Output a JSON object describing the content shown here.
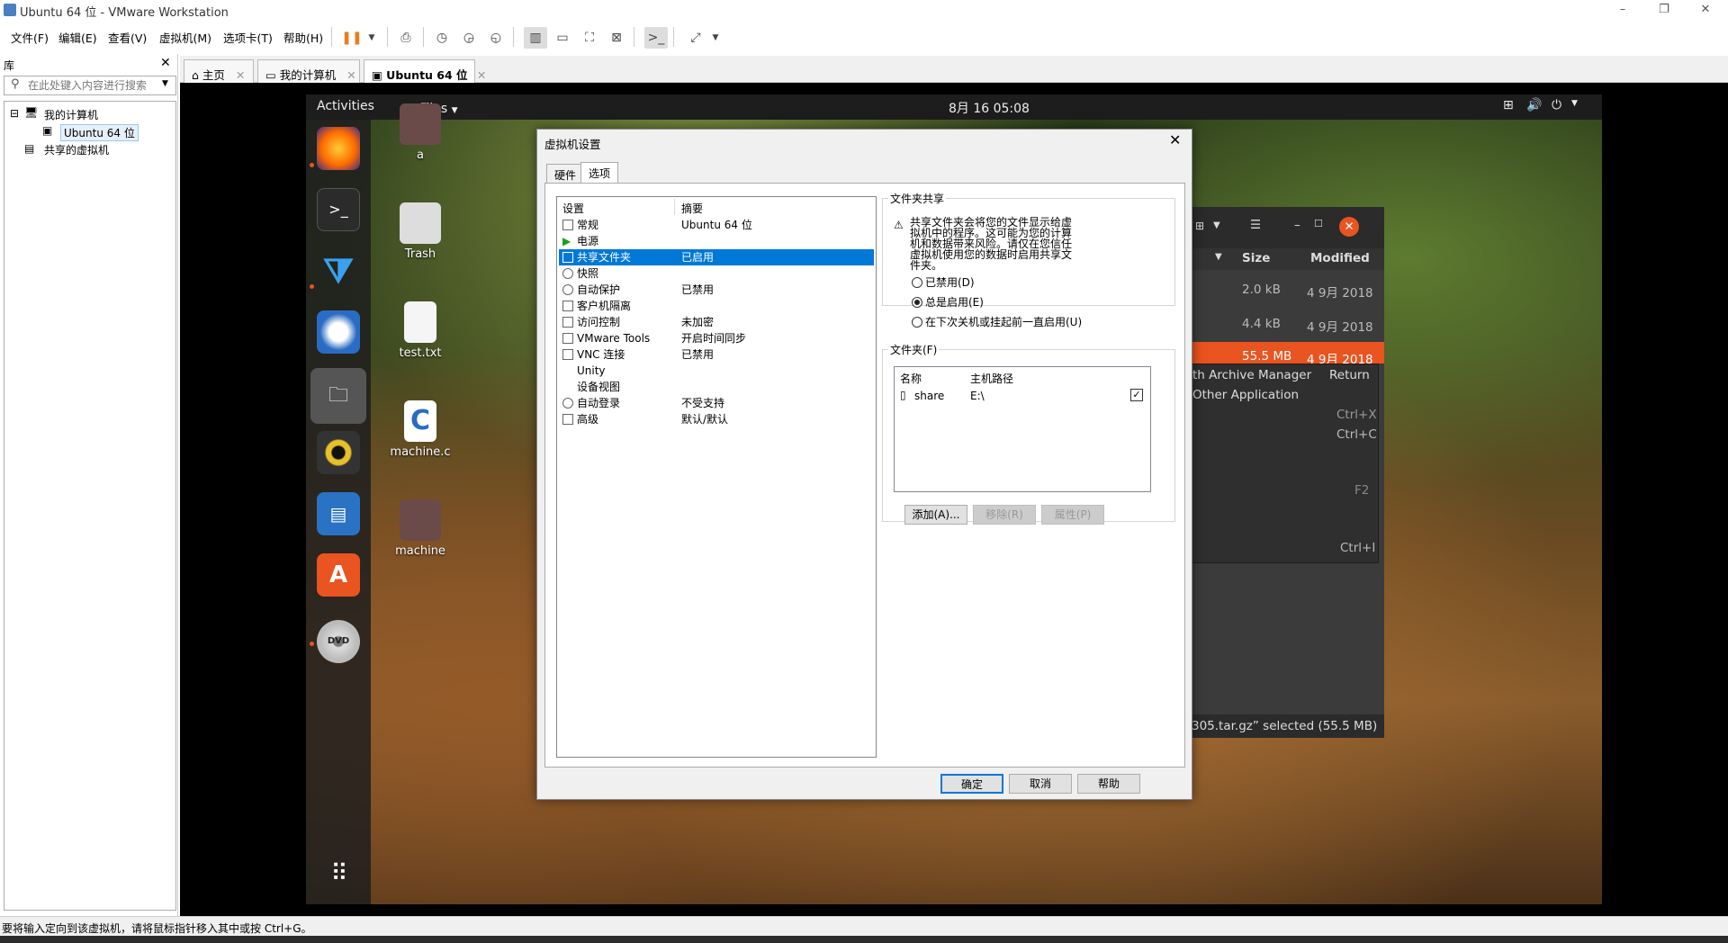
{
  "window": {
    "title": "Ubuntu 64 位 - VMware Workstation",
    "min": "–",
    "max": "❐",
    "close": "✕"
  },
  "menu": [
    "文件(F)",
    "编辑(E)",
    "查看(V)",
    "虚拟机(M)",
    "选项卡(T)",
    "帮助(H)"
  ],
  "library": {
    "title": "库",
    "close": "✕",
    "search_placeholder": "在此处键入内容进行搜索",
    "tree": {
      "root": "我的计算机",
      "vm": "Ubuntu 64 位",
      "shared": "共享的虚拟机"
    }
  },
  "tabs": [
    {
      "label": "主页"
    },
    {
      "label": "我的计算机"
    },
    {
      "label": "Ubuntu 64 位"
    }
  ],
  "ubuntu": {
    "activities": "Activities",
    "app_menu": "Files",
    "clock": "8月 16  05:08",
    "desktop": [
      {
        "label": "a"
      },
      {
        "label": "Trash"
      },
      {
        "label": "test.txt"
      },
      {
        "label": "machine.c"
      },
      {
        "label": "machine"
      }
    ]
  },
  "nautilus": {
    "col_size": "Size",
    "col_modified": "Modified",
    "rows": [
      {
        "size": "2.0 kB",
        "modified": "4 9月 2018"
      },
      {
        "size": "4.4 kB",
        "modified": "4 9月 2018"
      },
      {
        "size": "55.5 MB",
        "modified": "4 9月 2018"
      }
    ],
    "context": [
      {
        "label": "th Archive Manager",
        "shortcut": "Return"
      },
      {
        "label": "Other Application",
        "shortcut": ""
      },
      {
        "label": "",
        "shortcut": "Ctrl+X"
      },
      {
        "label": "",
        "shortcut": "Ctrl+C"
      },
      {
        "label": "",
        "shortcut": "F2"
      },
      {
        "label": "",
        "shortcut": "Ctrl+I"
      }
    ],
    "status": "305.tar.gz” selected  (55.5 MB)"
  },
  "dialog": {
    "title": "虚拟机设置",
    "tabs": [
      "硬件",
      "选项"
    ],
    "list_header": {
      "setting": "设置",
      "summary": "摘要"
    },
    "settings": [
      {
        "name": "常规",
        "value": "Ubuntu 64 位"
      },
      {
        "name": "电源",
        "value": ""
      },
      {
        "name": "共享文件夹",
        "value": "已启用"
      },
      {
        "name": "快照",
        "value": ""
      },
      {
        "name": "自动保护",
        "value": "已禁用"
      },
      {
        "name": "客户机隔离",
        "value": ""
      },
      {
        "name": "访问控制",
        "value": "未加密"
      },
      {
        "name": "VMware Tools",
        "value": "开启时间同步"
      },
      {
        "name": "VNC 连接",
        "value": "已禁用"
      },
      {
        "name": "Unity",
        "value": ""
      },
      {
        "name": "设备视图",
        "value": ""
      },
      {
        "name": "自动登录",
        "value": "不受支持"
      },
      {
        "name": "高级",
        "value": "默认/默认"
      }
    ],
    "sharing": {
      "legend": "文件夹共享",
      "warning": "共享文件夹会将您的文件显示给虚拟机中的程序。这可能为您的计算机和数据带来风险。请仅在您信任虚拟机使用您的数据时启用共享文件夹。",
      "options": [
        "已禁用(D)",
        "总是启用(E)",
        "在下次关机或挂起前一直启用(U)"
      ]
    },
    "folders": {
      "legend": "文件夹(F)",
      "col_name": "名称",
      "col_path": "主机路径",
      "rows": [
        {
          "name": "share",
          "path": "E:\\"
        }
      ],
      "add": "添加(A)...",
      "remove": "移除(R)",
      "props": "属性(P)"
    },
    "ok": "确定",
    "cancel": "取消",
    "help": "帮助"
  },
  "statusbar": "要将输入定向到该虚拟机，请将鼠标指针移入其中或按 Ctrl+G。"
}
